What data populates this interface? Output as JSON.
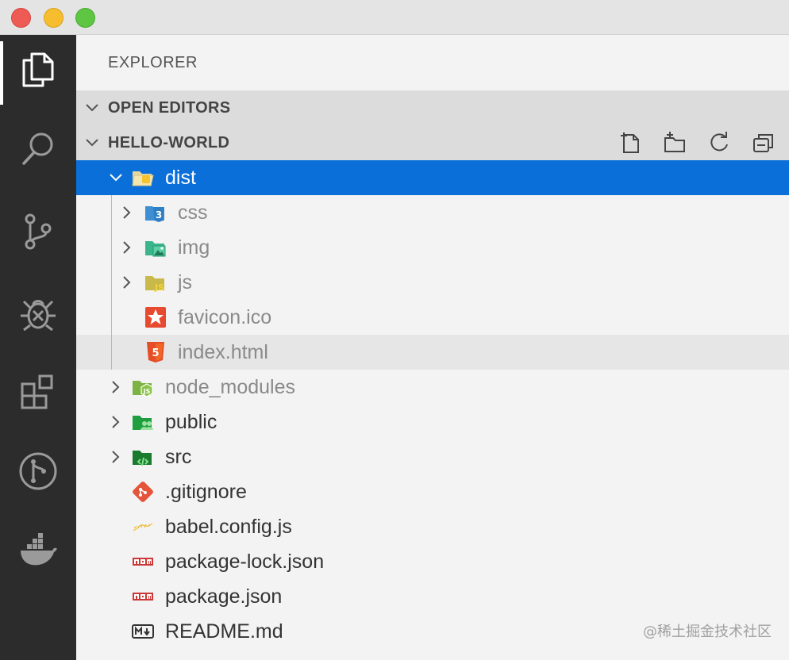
{
  "window": {
    "controls": [
      "close",
      "minimize",
      "zoom"
    ]
  },
  "activity_bar": {
    "items": [
      "explorer",
      "search",
      "source-control",
      "debug",
      "extensions",
      "git-graph",
      "docker"
    ],
    "active": "explorer"
  },
  "sidebar": {
    "title": "EXPLORER",
    "sections": {
      "open_editors": "OPEN EDITORS",
      "workspace": "HELLO-WORLD"
    },
    "actions": [
      "new-file",
      "new-folder",
      "refresh",
      "collapse-all"
    ]
  },
  "tree": {
    "dist": "dist",
    "css": "css",
    "img": "img",
    "js": "js",
    "favicon": "favicon.ico",
    "index": "index.html",
    "node_modules": "node_modules",
    "public": "public",
    "src": "src",
    "gitignore": ".gitignore",
    "babel": "babel.config.js",
    "package_lock": "package-lock.json",
    "package": "package.json",
    "readme": "README.md"
  },
  "colors": {
    "selection": "#0a6fd8",
    "activity_bar": "#2c2c2c",
    "sidebar": "#f3f3f3"
  },
  "watermark": "@稀土掘金技术社区"
}
